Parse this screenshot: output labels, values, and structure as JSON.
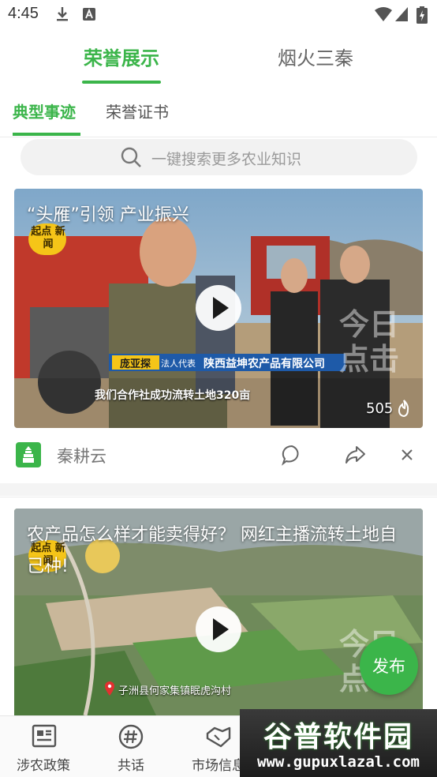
{
  "status_bar": {
    "time": "4:45"
  },
  "top_tabs": [
    {
      "label": "荣誉展示",
      "active": true
    },
    {
      "label": "烟火三秦",
      "active": false
    }
  ],
  "sub_tabs": [
    {
      "label": "典型事迹",
      "active": true
    },
    {
      "label": "荣誉证书",
      "active": false
    }
  ],
  "search": {
    "placeholder": "一键搜索更多农业知识"
  },
  "feed": [
    {
      "title": "“头雁”引领 产业振兴",
      "caption_name": "庞亚探",
      "caption_role": "法人代表",
      "caption_company": "陕西益坤农产品有限公司",
      "subtitle": "我们合作社成功流转土地320亩",
      "watermark": "今日 点击",
      "badge": "起点 新闻",
      "views": "505",
      "source": "秦耕云"
    },
    {
      "title": "农产品怎么样才能卖得好？ 网红主播流转土地自己种!",
      "location": "子洲县何家集镇眠虎沟村",
      "watermark": "今日 点击",
      "badge": "起点 新闻"
    }
  ],
  "fab": {
    "label": "发布"
  },
  "bottom_nav": [
    {
      "label": "涉农政策",
      "icon": "newspaper-icon"
    },
    {
      "label": "共话",
      "icon": "hashtag-icon"
    },
    {
      "label": "市场信息",
      "icon": "handshake-icon"
    }
  ],
  "ad_banner": {
    "title": "谷普软件园",
    "url": "www.gupuxlazal.com"
  },
  "colors": {
    "accent": "#3bb54a",
    "text_muted": "#777777"
  }
}
